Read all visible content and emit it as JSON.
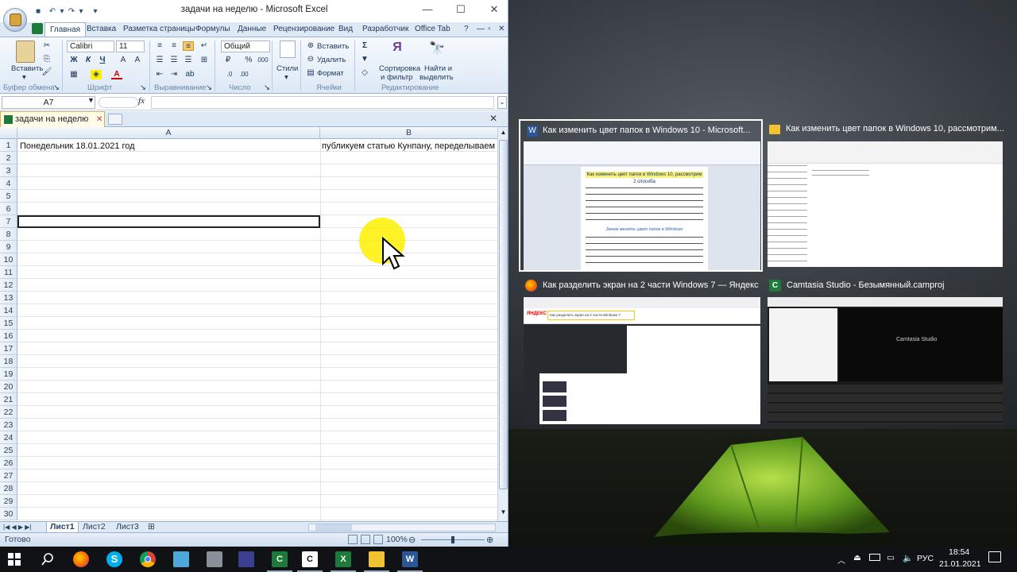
{
  "excel": {
    "title": "задачи на неделю - Microsoft Excel",
    "tabs": [
      "Главная",
      "Вставка",
      "Разметка страницы",
      "Формулы",
      "Данные",
      "Рецензирование",
      "Вид",
      "Разработчик",
      "Office Tab"
    ],
    "ribbon": {
      "font_name": "Calibri",
      "font_size": "11",
      "number_format": "Общий",
      "paste": "Вставить",
      "styles": "Стили",
      "insert": "Вставить",
      "delete": "Удалить",
      "format": "Формат",
      "sort_filter": [
        "Сортировка",
        "и фильтр"
      ],
      "find_select": [
        "Найти и",
        "выделить"
      ],
      "groups": {
        "clipboard": "Буфер обмена",
        "font": "Шрифт",
        "alignment": "Выравнивание",
        "number": "Число",
        "cells": "Ячейки",
        "editing": "Редактирование"
      }
    },
    "name_box": "A7",
    "fx": "fx",
    "workbook_tab": "задачи на неделю",
    "columns": [
      "A",
      "B"
    ],
    "rows": [
      "1",
      "2",
      "3",
      "4",
      "5",
      "6",
      "7",
      "8",
      "9",
      "10",
      "11",
      "12",
      "13",
      "14",
      "15",
      "16",
      "17",
      "18",
      "19",
      "20",
      "21",
      "22",
      "23",
      "24",
      "25",
      "26",
      "27",
      "28",
      "29",
      "30"
    ],
    "cells": {
      "A1": "Понедельник  18.01.2021 год",
      "B1": "публикуем статью Кунпану, переделываем"
    },
    "sheets": [
      "Лист1",
      "Лист2",
      "Лист3"
    ],
    "status": "Готово",
    "zoom": "100%"
  },
  "taskview": [
    {
      "title": "Как изменить цвет папок в Windows 10 - Microsoft...",
      "app": "word"
    },
    {
      "title": "Как изменить цвет папок в Windows 10, рассмотрим...",
      "app": "explorer"
    },
    {
      "title": "Как разделить экран на 2 части Windows 7 — Яндекс...",
      "app": "firefox"
    },
    {
      "title": "Camtasia Studio - Безымянный.camproj",
      "app": "camtasia"
    }
  ],
  "preview_text": {
    "word_heading": [
      "Как изменить цвет папок в Windows 10, рассмотрим",
      "2 способа"
    ],
    "word_sub": "Зачем менять цвет папок в Windows",
    "yandex_logo": "ЯНДЕКС",
    "yandex_query": "Как разделить экран на 2 части Windows 7",
    "camtasia_logo": "Camtasia Studio"
  },
  "taskbar": {
    "lang": "РУС",
    "time": "18:54",
    "date": "21.01.2021"
  },
  "colors": {
    "excel_green": "#1d7a3a",
    "selected_border": "#ffffff",
    "highlight": "#ffef00"
  }
}
